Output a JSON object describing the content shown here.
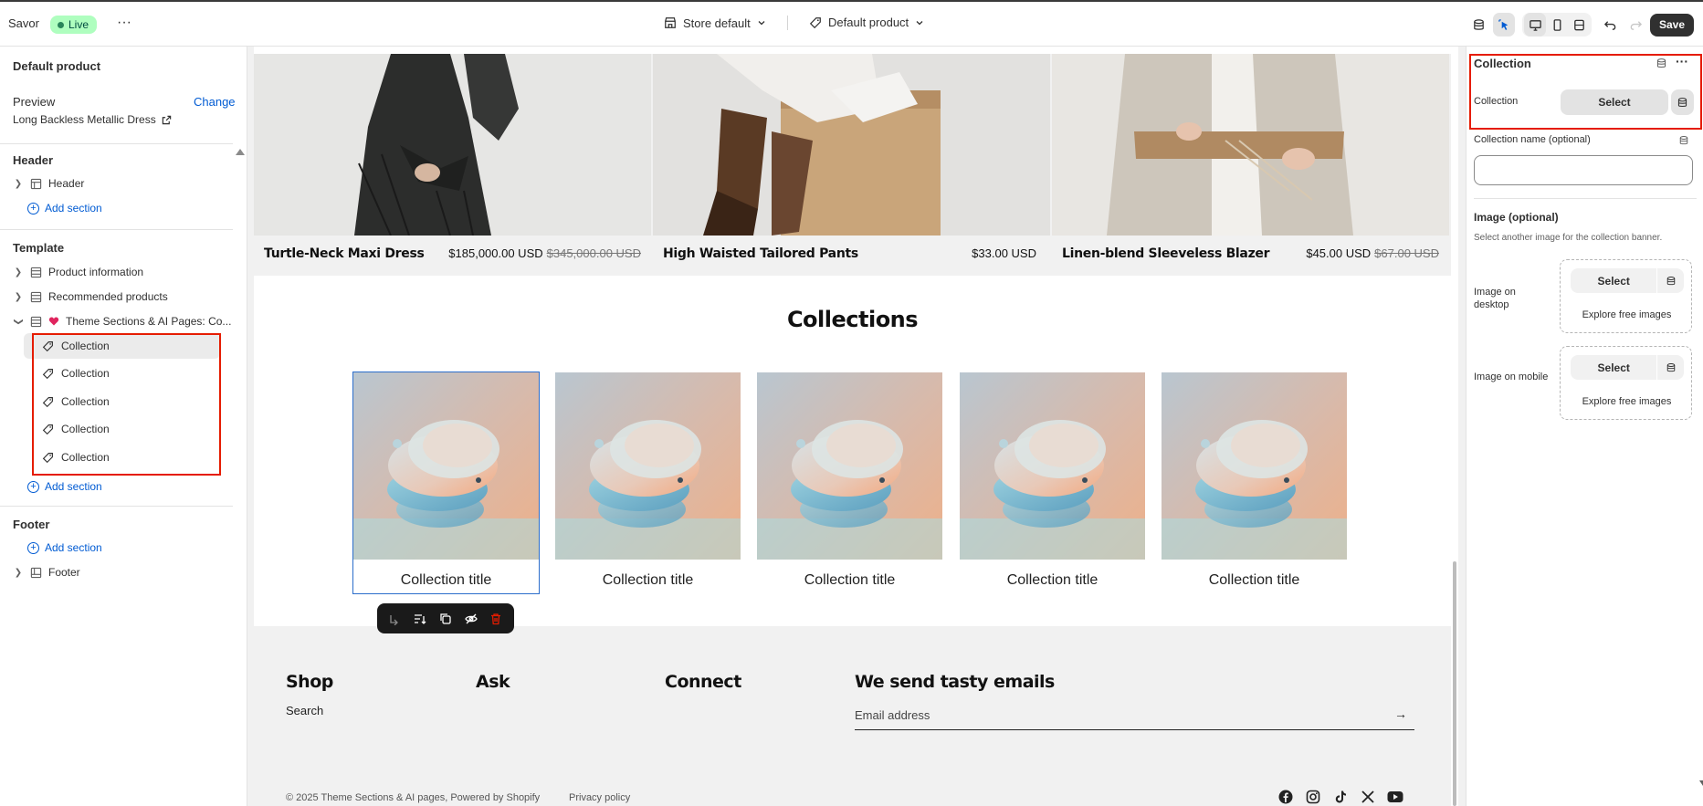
{
  "topbar": {
    "store_name": "Savor",
    "live_label": "Live",
    "more_glyph": "···",
    "store_default": "Store default",
    "default_product": "Default product",
    "save_label": "Save"
  },
  "sidebar": {
    "page_title": "Default product",
    "preview_label": "Preview",
    "change_label": "Change",
    "preview_value": "Long Backless Metallic Dress",
    "header_group": "Header",
    "header_item": "Header",
    "add_section": "Add section",
    "template_group": "Template",
    "template_items": [
      "Product information",
      "Recommended products"
    ],
    "theme_sections_item": "Theme Sections & AI Pages: Co...",
    "collection_blocks": [
      "Collection",
      "Collection",
      "Collection",
      "Collection",
      "Collection"
    ],
    "footer_group": "Footer",
    "footer_item": "Footer"
  },
  "canvas": {
    "products": [
      {
        "name": "Turtle-Neck Maxi Dress",
        "price": "$185,000.00 USD",
        "compare_price": "$345,000.00 USD"
      },
      {
        "name": "High Waisted Tailored Pants",
        "price": "$33.00 USD",
        "compare_price": ""
      },
      {
        "name": "Linen-blend Sleeveless Blazer",
        "price": "$45.00 USD",
        "compare_price": "$67.00 USD"
      }
    ],
    "collections_heading": "Collections",
    "collection_titles": [
      "Collection title",
      "Collection title",
      "Collection title",
      "Collection title",
      "Collection title"
    ],
    "footer": {
      "shop": "Shop",
      "ask": "Ask",
      "connect": "Connect",
      "newsletter": "We send tasty emails",
      "search_link": "Search",
      "email_placeholder": "Email address",
      "copyright": "© 2025 Theme Sections & AI pages, Powered by Shopify",
      "privacy": "Privacy policy"
    }
  },
  "settings": {
    "title": "Collection",
    "collection_label": "Collection",
    "select_label": "Select",
    "collection_name_label": "Collection name (optional)",
    "image_heading": "Image (optional)",
    "image_help": "Select another image for the collection banner.",
    "image_desktop_label": "Image on desktop",
    "image_mobile_label": "Image on mobile",
    "explore_label": "Explore free images"
  },
  "colors": {
    "accent": "#005bd3",
    "live_bg": "#affebf",
    "highlight": "#e51c00",
    "save_bg": "#303030"
  }
}
